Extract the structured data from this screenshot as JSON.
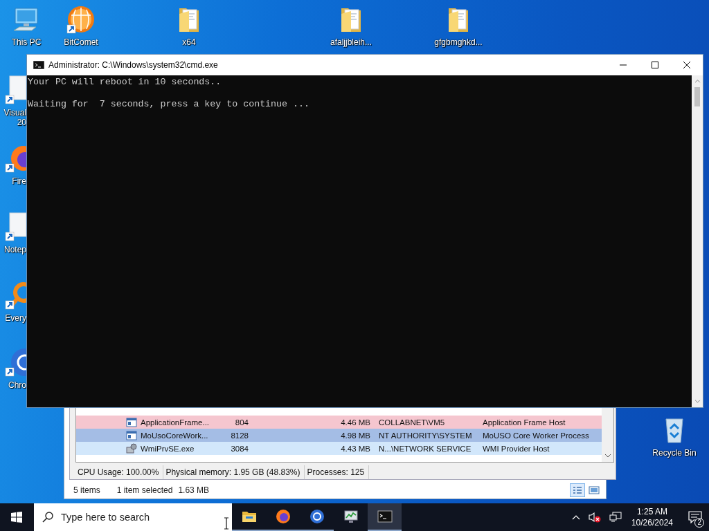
{
  "desktop": {
    "icons": [
      {
        "lines": [
          "This PC"
        ],
        "kind": "computer",
        "shortcut": false
      },
      {
        "lines": [
          "BitComet"
        ],
        "kind": "torrent",
        "shortcut": true
      },
      {
        "lines": [
          "x64"
        ],
        "kind": "folder",
        "shortcut": false
      },
      {
        "lines": [
          "afaljjbleih..."
        ],
        "kind": "folder",
        "shortcut": false
      },
      {
        "lines": [
          "gfgbmghkd..."
        ],
        "kind": "folder",
        "shortcut": false
      },
      {
        "lines": [
          "Visual",
          "20"
        ],
        "kind": "page",
        "shortcut": true
      },
      {
        "lines": [
          "Fire"
        ],
        "kind": "firefox",
        "shortcut": true
      },
      {
        "lines": [
          "Notep"
        ],
        "kind": "page",
        "shortcut": true
      },
      {
        "lines": [
          "Every"
        ],
        "kind": "magnifier",
        "shortcut": true
      },
      {
        "lines": [
          "Chro"
        ],
        "kind": "chrome",
        "shortcut": true
      },
      {
        "lines": [
          "Recycle Bin"
        ],
        "kind": "bin",
        "shortcut": false
      }
    ]
  },
  "explorer_status": {
    "items": "5 items",
    "selection": "1 item selected",
    "size": "1.63 MB",
    "views": [
      {
        "kind": "details",
        "selected": true
      },
      {
        "kind": "preview",
        "selected": false
      }
    ]
  },
  "process_list": {
    "rows": [
      {
        "kind": "window",
        "name": "ApplicationFrame...",
        "pid": "804",
        "memory": "4.46 MB",
        "user": "COLLABNET\\VM5",
        "description": "Application Frame Host",
        "color": "#f5c6cf",
        "selected": false
      },
      {
        "kind": "window",
        "name": "MoUsoCoreWork...",
        "pid": "8128",
        "memory": "4.98 MB",
        "user": "NT AUTHORITY\\SYSTEM",
        "description": "MoUSO Core Worker Process",
        "selected": true
      },
      {
        "kind": "gear",
        "name": "WmiPrvSE.exe",
        "pid": "3084",
        "memory": "4.43 MB",
        "user": "N...\\NETWORK SERVICE",
        "description": "WMI Provider Host",
        "color": "#d2e7fb",
        "selected": false
      }
    ],
    "status": [
      "CPU Usage: 100.00%",
      "Physical memory: 1.95 GB (48.83%)",
      "Processes: 125"
    ]
  },
  "console": {
    "title": "Administrator: C:\\Windows\\system32\\cmd.exe",
    "lines": [
      "Your PC will reboot in 10 seconds..",
      "Waiting for  7 seconds, press a key to continue ..."
    ]
  },
  "taskbar": {
    "search": {
      "placeholder": "Type here to search"
    },
    "apps": [
      {
        "kind": "files",
        "running": true,
        "selected": false
      },
      {
        "kind": "firefox",
        "running": true,
        "selected": false
      },
      {
        "kind": "chrome",
        "running": true,
        "selected": false
      },
      {
        "kind": "monitor",
        "running": false,
        "selected": false
      },
      {
        "kind": "console",
        "running": true,
        "selected": true
      }
    ],
    "volume_muted": true,
    "clock": {
      "time": "1:25 AM",
      "date": "10/26/2024"
    },
    "notifications": "2"
  }
}
